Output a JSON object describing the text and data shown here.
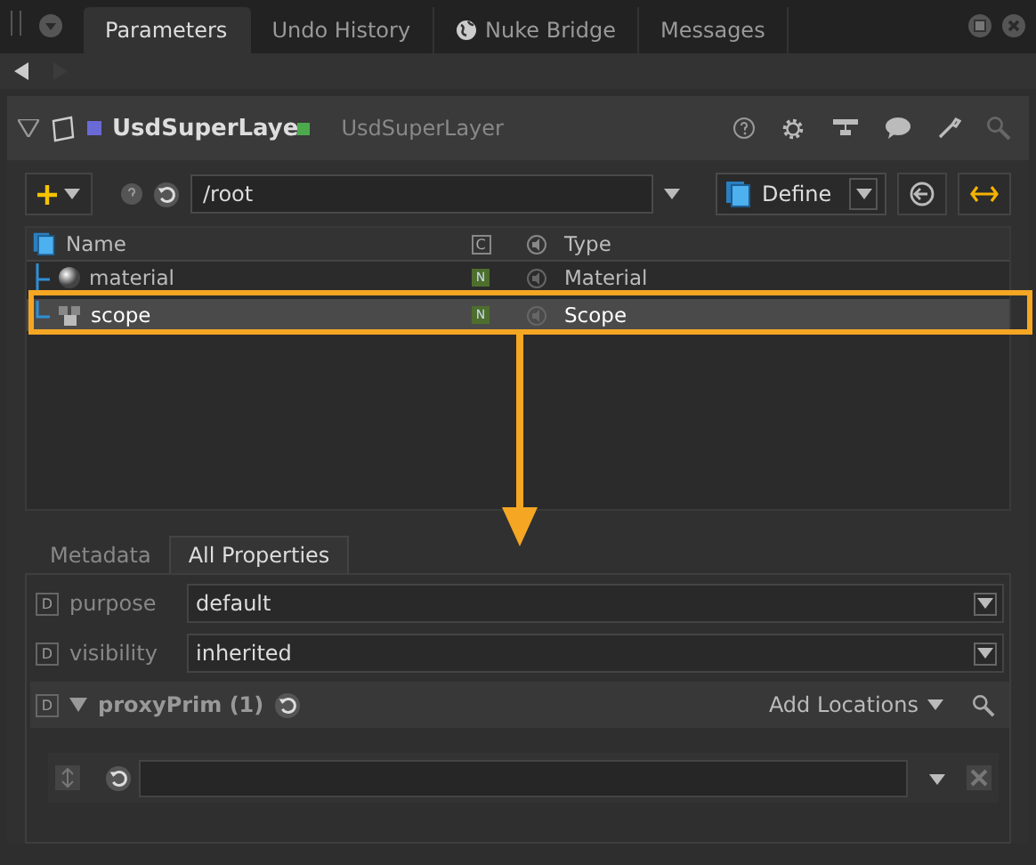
{
  "panel_tabs": [
    {
      "label": "Parameters",
      "selected": true,
      "kind": "plain"
    },
    {
      "label": "Undo History",
      "selected": false,
      "kind": "plain"
    },
    {
      "label": "Nuke Bridge",
      "selected": false,
      "kind": "globe"
    },
    {
      "label": "Messages",
      "selected": false,
      "kind": "plain"
    }
  ],
  "node": {
    "name": "UsdSuperLaye",
    "type": "UsdSuperLayer",
    "expanded": true
  },
  "toolbar": {
    "path": "/root",
    "mode": "Define"
  },
  "tree": {
    "columns": [
      "Name",
      "C",
      "Type"
    ],
    "rows": [
      {
        "name": "material",
        "badge": "N",
        "type": "Material",
        "kind": "sphere",
        "selected": false
      },
      {
        "name": "scope",
        "badge": "N",
        "type": "Scope",
        "kind": "scope",
        "selected": true
      }
    ]
  },
  "property_tabs": [
    {
      "label": "Metadata",
      "selected": false
    },
    {
      "label": "All Properties",
      "selected": true
    }
  ],
  "fields": [
    {
      "badge": "D",
      "label": "purpose",
      "value": "default"
    },
    {
      "badge": "D",
      "label": "visibility",
      "value": "inherited"
    }
  ],
  "group": {
    "badge": "D",
    "title": "proxyPrim (1)",
    "expanded": true,
    "action": "Add Locations"
  }
}
